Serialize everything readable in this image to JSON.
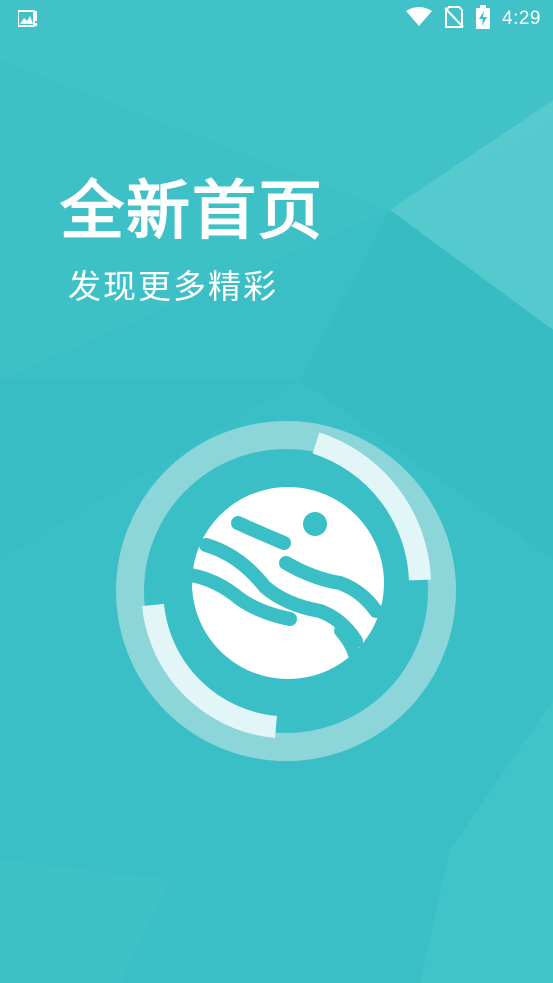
{
  "status_bar": {
    "left_icon": "image-notification-icon",
    "wifi_icon": "wifi-icon",
    "sim_icon": "no-sim-icon",
    "battery_icon": "battery-charging-icon",
    "time": "4:29"
  },
  "hero": {
    "title": "全新首页",
    "subtitle": "发现更多精彩"
  },
  "logo": {
    "icon": "app-logo-icon"
  },
  "colors": {
    "background": "#3bbfc6",
    "ring": "#8cd6da",
    "arc": "#e3f6f7",
    "text": "#ffffff"
  }
}
